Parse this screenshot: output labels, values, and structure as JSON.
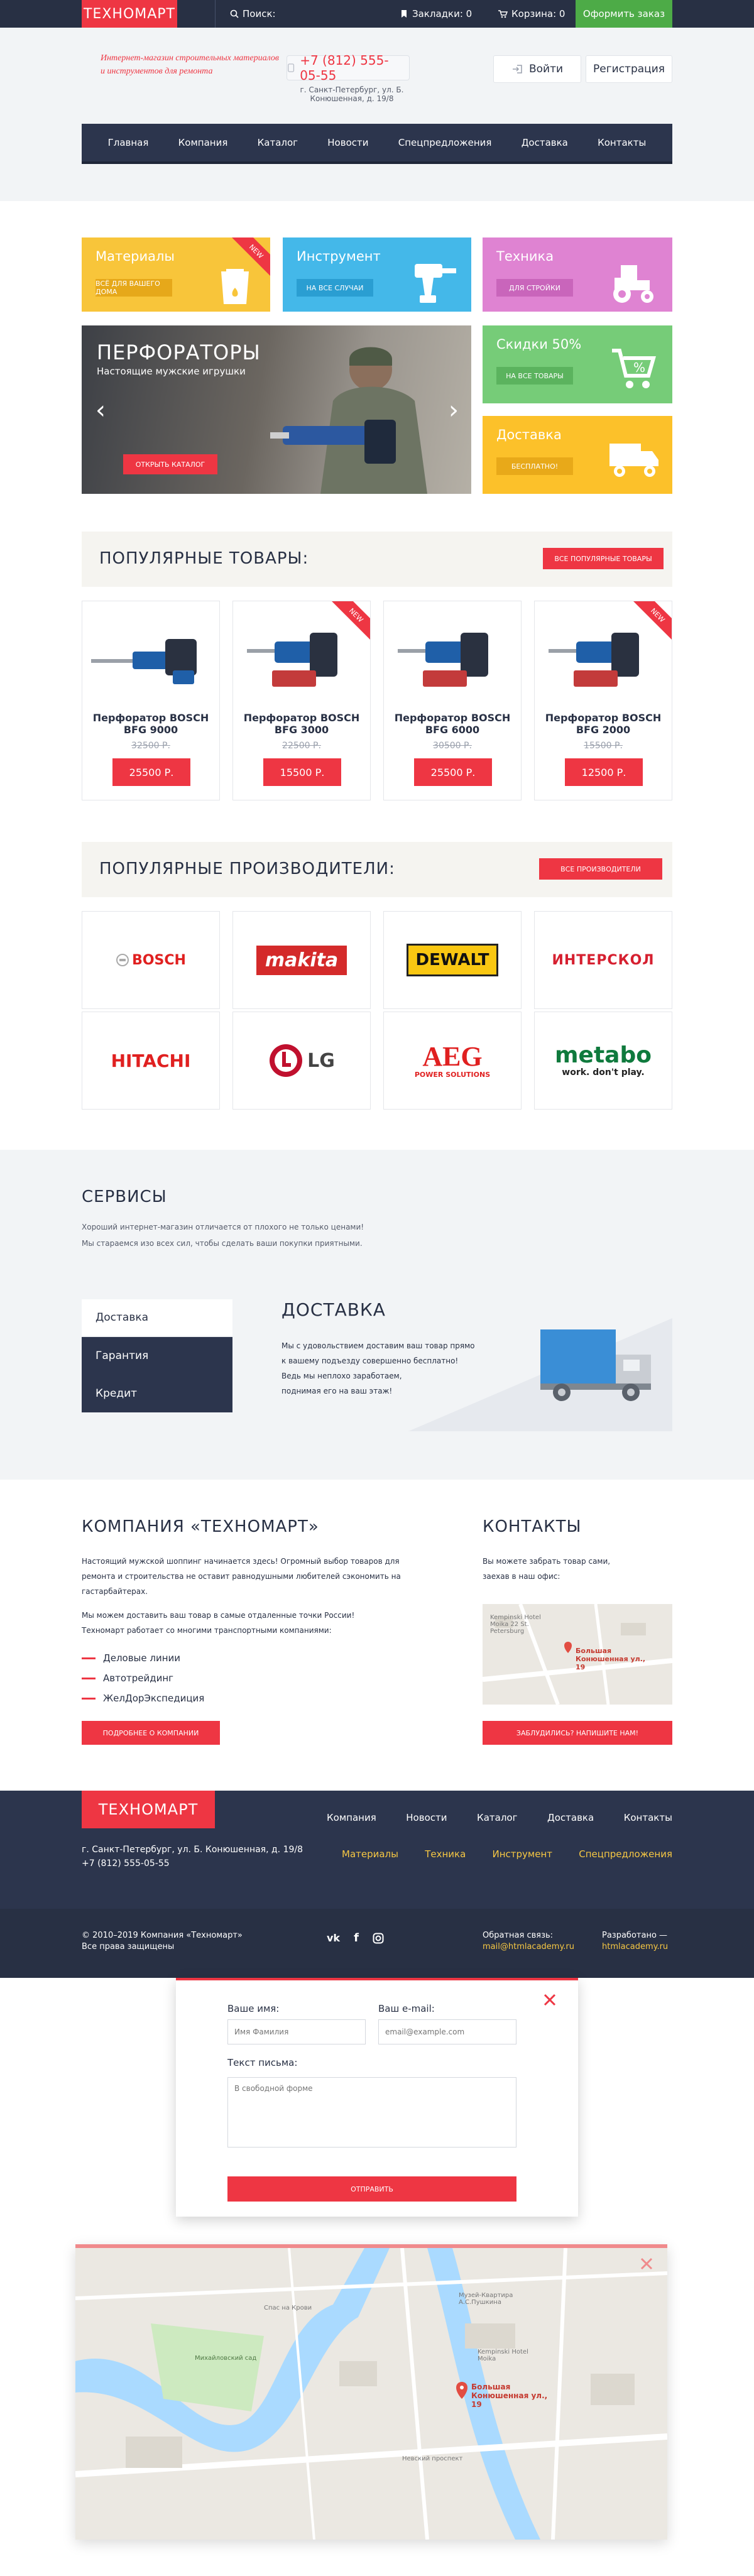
{
  "topbar": {
    "logo": "ТЕХНОМАРТ",
    "search_label": "Поиск:",
    "bookmarks_label": "Закладки: 0",
    "cart_label": "Корзина: 0",
    "order_label": "Оформить заказ"
  },
  "header": {
    "slogan": "Интернет-магазин строительных материалов и инструментов для ремонта",
    "phone": "+7 (812) 555-05-55",
    "address": "г. Санкт-Петербург, ул. Б. Конюшенная, д. 19/8",
    "login_label": "Войти",
    "register_label": "Регистрация"
  },
  "nav": {
    "items": [
      "Главная",
      "Компания",
      "Каталог",
      "Новости",
      "Спецпредложения",
      "Доставка",
      "Контакты"
    ]
  },
  "catalog": {
    "materials": {
      "title": "Материалы",
      "button": "ВСЁ ДЛЯ ВАШЕГО ДОМА",
      "ribbon": "NEW"
    },
    "tools": {
      "title": "Инструмент",
      "button": "НА ВСЕ СЛУЧАИ"
    },
    "machinery": {
      "title": "Техника",
      "button": "ДЛЯ СТРОЙКИ"
    },
    "discounts": {
      "title": "Скидки 50%",
      "button": "НА ВСЕ ТОВАРЫ"
    },
    "delivery": {
      "title": "Доставка",
      "button": "БЕСПЛАТНО!"
    },
    "colors": {
      "materials": "#f8c53a",
      "tools": "#44b8e9",
      "machinery": "#df83d2",
      "discounts": "#76cc78",
      "delivery": "#fcc12a",
      "accent": "#ee3643",
      "dark": "#283044"
    }
  },
  "slider": {
    "title": "ПЕРФОРАТОРЫ",
    "subtitle": "Настоящие мужские игрушки",
    "button": "ОТКРЫТЬ КАТАЛОГ"
  },
  "popular": {
    "title": "ПОПУЛЯРНЫЕ ТОВАРЫ:",
    "button": "ВСЕ ПОПУЛЯРНЫЕ ТОВАРЫ",
    "products": [
      {
        "name_line1": "Перфоратор BOSCH",
        "name_line2": "BFG 9000",
        "old_price": "32500 Р.",
        "price": "25500 Р.",
        "ribbon": ""
      },
      {
        "name_line1": "Перфоратор BOSCH",
        "name_line2": "BFG 3000",
        "old_price": "22500 Р.",
        "price": "15500 Р.",
        "ribbon": "NEW"
      },
      {
        "name_line1": "Перфоратор BOSCH",
        "name_line2": "BFG 6000",
        "old_price": "30500 Р.",
        "price": "25500 Р.",
        "ribbon": ""
      },
      {
        "name_line1": "Перфоратор BOSCH",
        "name_line2": "BFG 2000",
        "old_price": "15500 Р.",
        "price": "12500 Р.",
        "ribbon": "NEW"
      }
    ]
  },
  "brands": {
    "title": "ПОПУЛЯРНЫЕ ПРОИЗВОДИТЕЛИ:",
    "button": "ВСЕ ПРОИЗВОДИТЕЛИ",
    "items": [
      "BOSCH",
      "makita",
      "DEWALT",
      "ИНТЕРСКОЛ",
      "HITACHI",
      "LG",
      "AEG",
      "metabo"
    ],
    "aeg_sub": "POWER SOLUTIONS",
    "metabo_sub": "work. don't play."
  },
  "services": {
    "title": "СЕРВИСЫ",
    "line1": "Хороший интернет-магазин отличается от плохого не только ценами!",
    "line2": "Мы стараемся изо всех сил, чтобы сделать ваши покупки приятными.",
    "tabs": [
      "Доставка",
      "Гарантия",
      "Кредит"
    ],
    "panel_title": "ДОСТАВКА",
    "panel_text": [
      "Мы с удовольствием доставим ваш товар прямо",
      "к вашему подъезду совершенно бесплатно!",
      "Ведь мы неплохо заработаем,",
      "поднимая его на ваш этаж!"
    ]
  },
  "company": {
    "title": "КОМПАНИЯ «ТЕХНОМАРТ»",
    "p1": [
      "Настоящий мужской шоппинг начинается здесь! Огромный выбор товаров для",
      "ремонта и строительства не оставит равнодушными любителей сэкономить на",
      "гастарбайтерах."
    ],
    "p2": [
      "Мы можем доставить ваш товар в самые отдаленные точки России!",
      "Техномарт работает со многими транспортными компаниями:"
    ],
    "partners": [
      "Деловые линии",
      "Автотрейдинг",
      "ЖелДорЭкспедиция"
    ],
    "button": "ПОДРОБНЕЕ О КОМПАНИИ"
  },
  "contacts": {
    "title": "КОНТАКТЫ",
    "text": [
      "Вы можете забрать товар сами,",
      "заехав в наш офис:"
    ],
    "map_place": "Kempinski Hotel Moika 22 St. Petersburg",
    "map_label": "Большая Конюшенная ул., 19",
    "button": "ЗАБЛУДИЛИСЬ? НАПИШИТЕ НАМ!"
  },
  "footer": {
    "logo": "ТЕХНОМАРТ",
    "address": "г. Санкт-Петербург, ул. Б. Конюшенная, д. 19/8",
    "phone": "+7 (812) 555-05-55",
    "nav": [
      "Компания",
      "Новости",
      "Каталог",
      "Доставка",
      "Контакты"
    ],
    "cats": [
      "Материалы",
      "Техника",
      "Инструмент",
      "Спецпредложения"
    ],
    "copyright1": "© 2010–2019 Компания «Техномарт»",
    "copyright2": "Все права защищены",
    "social": [
      "vk",
      "f",
      "instagram"
    ],
    "feedback_label": "Обратная связь:",
    "feedback_email": "mail@htmlacademy.ru",
    "dev_label": "Разработано —",
    "dev_link": "htmlacademy.ru"
  },
  "feedback_form": {
    "name_label": "Ваше имя:",
    "name_placeholder": "Имя Фамилия",
    "email_label": "Ваш e-mail:",
    "email_placeholder": "email@example.com",
    "message_label": "Текст письма:",
    "message_placeholder": "В свободной форме",
    "submit": "ОТПРАВИТЬ"
  },
  "map_modal": {
    "place_label": "Большая Конюшенная ул., 19",
    "labels": [
      "Музей-Квартира А.С.Пушкина",
      "Kempinski Hotel Moika",
      "Михайловский сад",
      "Спас на Крови",
      "Невский проспект"
    ]
  }
}
